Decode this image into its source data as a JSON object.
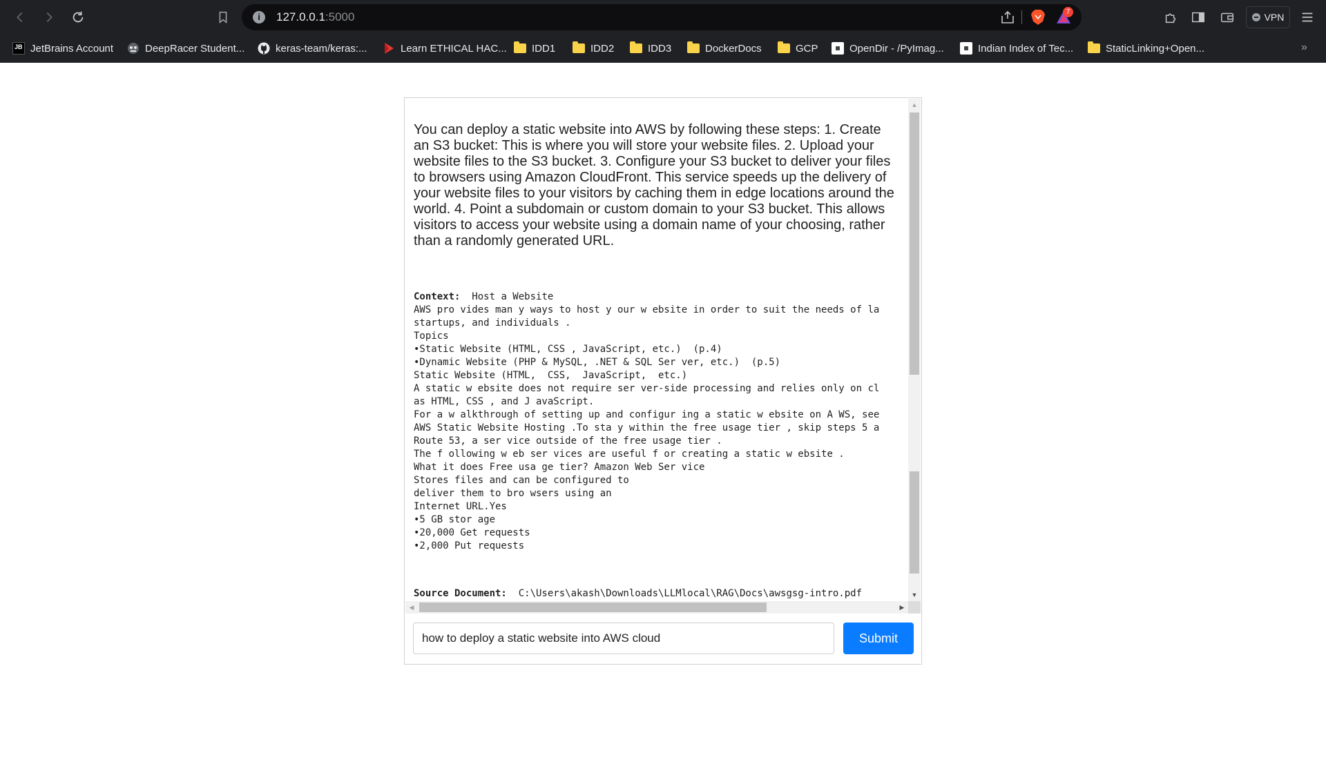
{
  "browser": {
    "url_host": "127.0.0.1",
    "url_port": ":5000",
    "rewards_badge": "7",
    "vpn_label": "VPN",
    "more_bookmarks": "»",
    "bookmarks": [
      {
        "label": "JetBrains Account",
        "icon": "jetbrains-icon"
      },
      {
        "label": "DeepRacer Student...",
        "icon": "deepracer-icon"
      },
      {
        "label": "keras-team/keras:...",
        "icon": "github-icon"
      },
      {
        "label": "Learn ETHICAL HAC...",
        "icon": "flag-icon"
      },
      {
        "label": "IDD1",
        "icon": "folder-icon"
      },
      {
        "label": "IDD2",
        "icon": "folder-icon"
      },
      {
        "label": "IDD3",
        "icon": "folder-icon"
      },
      {
        "label": "DockerDocs",
        "icon": "folder-icon"
      },
      {
        "label": "GCP",
        "icon": "folder-icon"
      },
      {
        "label": "OpenDir - /PyImag...",
        "icon": "page-icon"
      },
      {
        "label": "Indian Index of Tec...",
        "icon": "page-icon"
      },
      {
        "label": "StaticLinking+Open...",
        "icon": "folder-icon"
      }
    ]
  },
  "response": {
    "answer": "You can deploy a static website into AWS by following these steps: 1. Create an S3 bucket: This is where you will store your website files. 2. Upload your website files to the S3 bucket. 3. Configure your S3 bucket to deliver your files to browsers using Amazon CloudFront. This service speeds up the delivery of your website files to your visitors by caching them in edge locations around the world. 4. Point a subdomain or custom domain to your S3 bucket. This allows visitors to access your website using a domain name of your choosing, rather than a randomly generated URL.",
    "context_label": "Context:",
    "context_first": "  Host a Website",
    "context_text": "AWS pro vides man y ways to host y our w ebsite in order to suit the needs of la\nstartups, and individuals .\nTopics\n•Static Website (HTML, CSS , JavaScript, etc.)  (p.4)\n•Dynamic Website (PHP & MySQL, .NET & SQL Ser ver, etc.)  (p.5)\nStatic Website (HTML,  CSS,  JavaScript,  etc.)\nA static w ebsite does not require ser ver-side processing and relies only on cl\nas HTML, CSS , and J avaScript.\nFor a w alkthrough of setting up and configur ing a static w ebsite on A WS, see\nAWS Static Website Hosting .To sta y within the free usage tier , skip steps 5 a\nRoute 53, a ser vice outside of the free usage tier .\nThe f ollowing w eb ser vices are useful f or creating a static w ebsite .\nWhat it does Free usa ge tier? Amazon Web Ser vice\nStores files and can be configured to\ndeliver them to bro wsers using an\nInternet URL.Yes\n•5 GB stor age\n•20,000 Get requests\n•2,000 Put requests",
    "source_label": "Source Document:",
    "source_path": "  C:\\Users\\akash\\Downloads\\LLMlocal\\RAG\\Docs\\awsgsg-intro.pdf"
  },
  "form": {
    "query_value": "how to deploy a static website into AWS cloud",
    "submit_label": "Submit"
  },
  "colors": {
    "chrome_bg": "#202124",
    "submit_bg": "#0a7cff"
  }
}
